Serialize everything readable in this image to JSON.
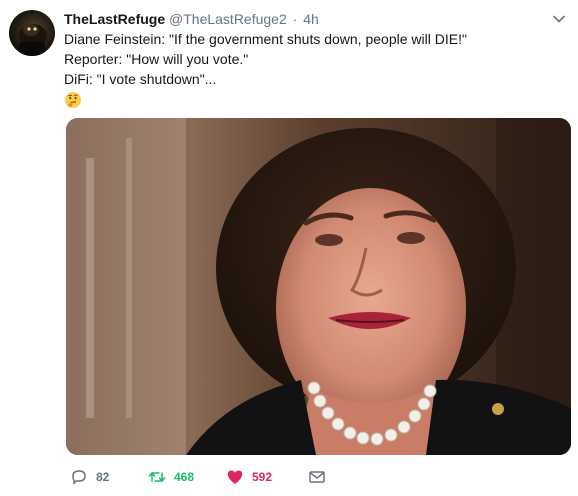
{
  "author": {
    "display_name": "TheLastRefuge",
    "handle": "@TheLastRefuge2",
    "separator": "·",
    "time": "4h"
  },
  "tweet": {
    "lines": [
      "Diane Feinstein: \"If the government shuts down, people will DIE!\"",
      "Reporter: \"How will you vote.\"",
      "DiFi: \"I vote shutdown\"..."
    ],
    "emoji": "thinking-face"
  },
  "media": {
    "kind": "photo"
  },
  "actions": {
    "reply_count": "82",
    "retweet_count": "468",
    "like_count": "592"
  },
  "colors": {
    "text": "#14171a",
    "muted": "#657786",
    "retweet": "#17bf63",
    "like": "#e0245e"
  },
  "icons": {
    "caret": "chevron-down-icon",
    "reply": "reply-icon",
    "retweet": "retweet-icon",
    "like": "heart-icon",
    "dm": "envelope-icon"
  }
}
